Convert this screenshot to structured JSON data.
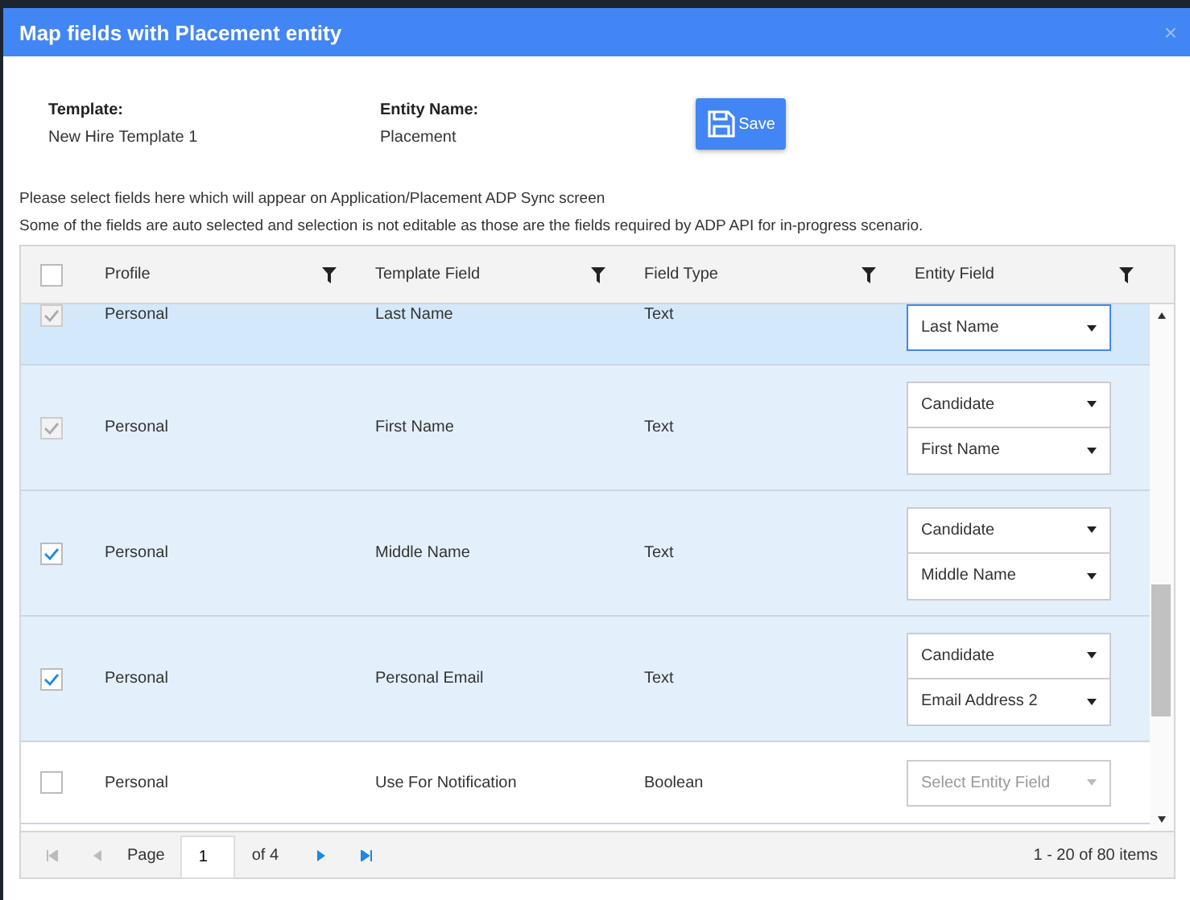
{
  "window": {
    "title": "Map fields with Placement entity",
    "close": "×"
  },
  "info": [
    {
      "label": "Template:",
      "value": "New Hire Template 1"
    },
    {
      "label": "Entity Name:",
      "value": "Placement"
    }
  ],
  "save_button": {
    "label": "Save"
  },
  "notes": [
    "Please select fields here which will appear on Application/Placement ADP Sync screen",
    "Some of the fields are auto selected and selection is not editable as those are the fields required by ADP API for in-progress scenario."
  ],
  "table": {
    "select_all_checked": false,
    "columns": [
      "Profile",
      "Template Field",
      "Field Type",
      "Entity Field"
    ],
    "rows": [
      {
        "checked": true,
        "disabled": true,
        "selected": true,
        "active": true,
        "profile": "Personal",
        "template_field": "Last Name",
        "field_type": "Text",
        "entity_fields": [
          {
            "value": "Last Name"
          }
        ]
      },
      {
        "checked": true,
        "disabled": true,
        "selected": true,
        "active": false,
        "profile": "Personal",
        "template_field": "First Name",
        "field_type": "Text",
        "entity_fields": [
          {
            "value": "Candidate"
          },
          {
            "value": "First Name"
          }
        ]
      },
      {
        "checked": true,
        "disabled": false,
        "selected": true,
        "active": false,
        "profile": "Personal",
        "template_field": "Middle Name",
        "field_type": "Text",
        "entity_fields": [
          {
            "value": "Candidate"
          },
          {
            "value": "Middle Name"
          }
        ]
      },
      {
        "checked": true,
        "disabled": false,
        "selected": true,
        "active": false,
        "profile": "Personal",
        "template_field": "Personal Email",
        "field_type": "Text",
        "entity_fields": [
          {
            "value": "Candidate"
          },
          {
            "value": "Email Address 2"
          }
        ]
      },
      {
        "checked": false,
        "disabled": false,
        "selected": false,
        "active": false,
        "profile": "Personal",
        "template_field": "Use For Notification",
        "field_type": "Boolean",
        "entity_fields": [
          {
            "placeholder": "Select Entity Field",
            "disabled": true
          }
        ]
      }
    ]
  },
  "pager": {
    "page_label": "Page",
    "page": "1",
    "of": "of 4",
    "summary": "1 - 20 of 80 items"
  }
}
